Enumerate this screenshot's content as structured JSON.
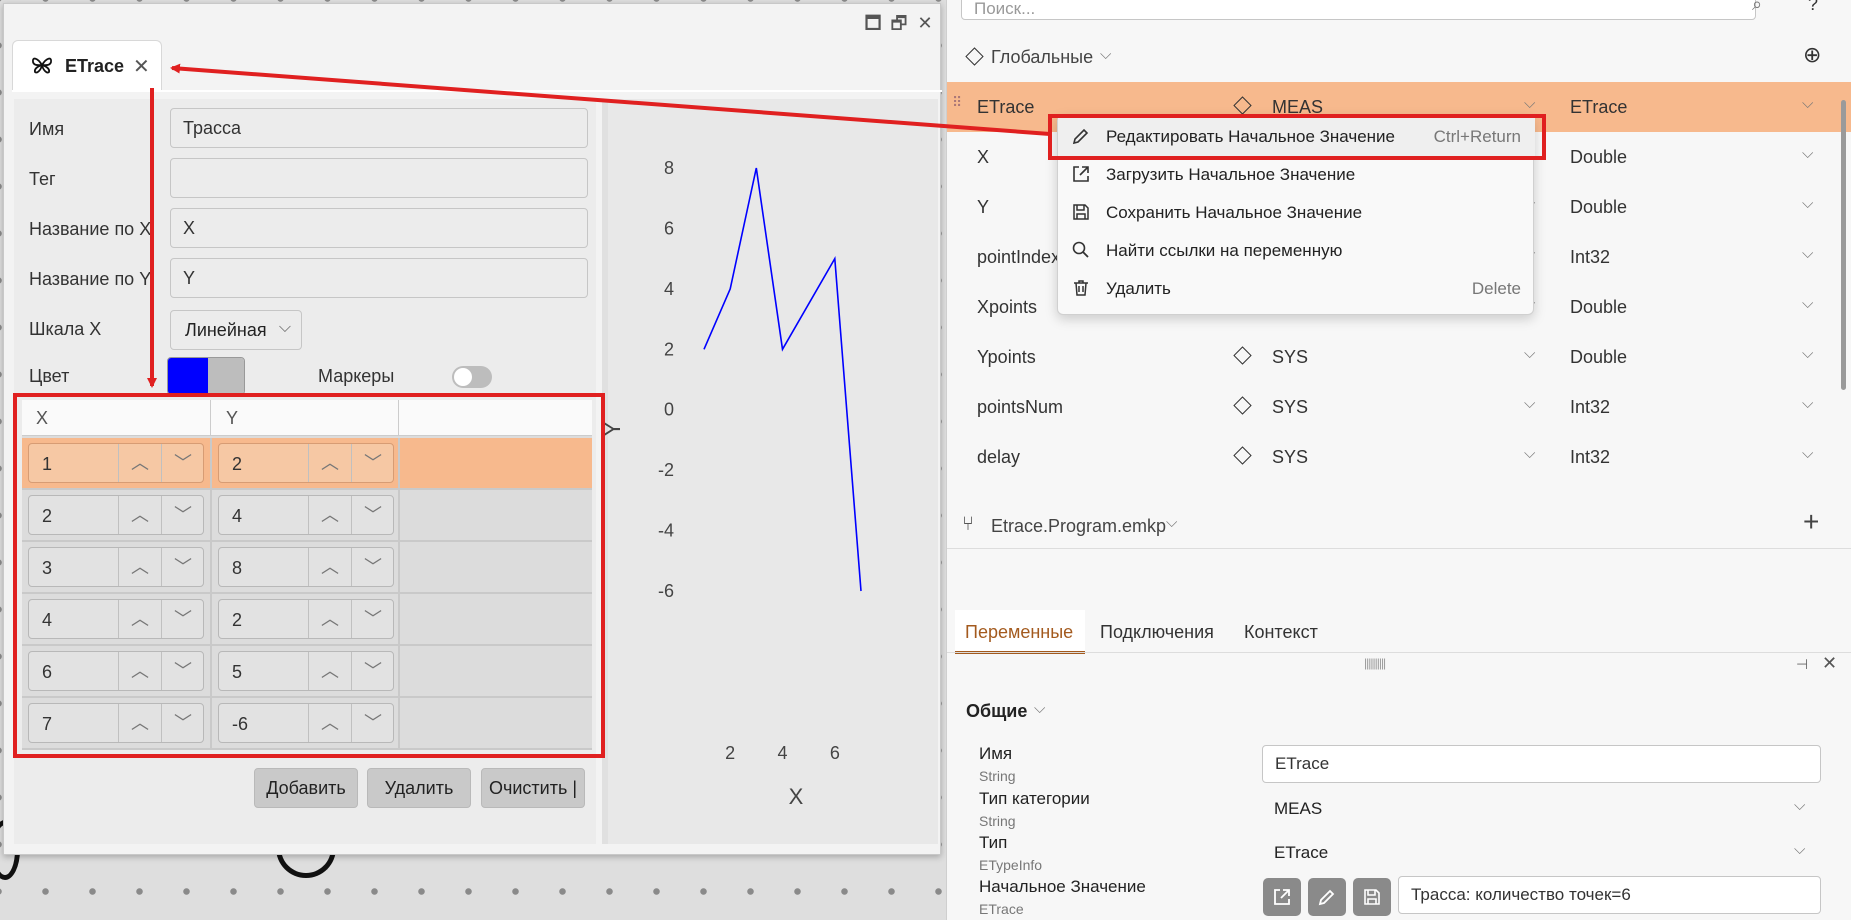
{
  "window": {
    "tab_title": "ETrace",
    "tab_close": "✕",
    "controls": {
      "minimize": "🗖",
      "restore": "🗗",
      "close": "✕"
    }
  },
  "form": {
    "name_label": "Имя",
    "name_value": "Трасса",
    "tag_label": "Тег",
    "tag_value": "",
    "xname_label": "Название по X",
    "xname_value": "X",
    "yname_label": "Название по Y",
    "yname_value": "Y",
    "scale_label": "Шкала X",
    "scale_value": "Линейная",
    "color_label": "Цвет",
    "color_value": "#0000ff",
    "markers_label": "Маркеры",
    "markers_on": false
  },
  "table": {
    "columns": [
      "X",
      "Y"
    ],
    "rows": [
      {
        "x": "1",
        "y": "2",
        "selected": true
      },
      {
        "x": "2",
        "y": "4",
        "selected": false
      },
      {
        "x": "3",
        "y": "8",
        "selected": false
      },
      {
        "x": "4",
        "y": "2",
        "selected": false
      },
      {
        "x": "6",
        "y": "5",
        "selected": false
      },
      {
        "x": "7",
        "y": "-6",
        "selected": false
      }
    ]
  },
  "buttons": {
    "add": "Добавить",
    "delete": "Удалить",
    "clear": "Очистить |"
  },
  "chart_data": {
    "type": "line",
    "x": [
      1,
      2,
      3,
      4,
      6,
      7
    ],
    "series": [
      {
        "values": [
          2,
          4,
          8,
          2,
          5,
          -6
        ],
        "color": "#0000ff"
      }
    ],
    "xlabel": "X",
    "ylabel": "Y",
    "xticks": [
      2,
      4,
      6
    ],
    "yticks": [
      8,
      6,
      4,
      2,
      0,
      -2,
      -4,
      -6
    ]
  },
  "right": {
    "search_placeholder": "Поиск...",
    "globals_label": "Глобальные",
    "variables": [
      {
        "name": "ETrace",
        "category": "MEAS",
        "type": "ETrace",
        "selected": true
      },
      {
        "name": "X",
        "category": "",
        "type": "Double"
      },
      {
        "name": "Y",
        "category": "",
        "type": "Double"
      },
      {
        "name": "pointIndex",
        "category": "",
        "type": "Int32"
      },
      {
        "name": "Xpoints",
        "category": "",
        "type": "Double"
      },
      {
        "name": "Ypoints",
        "category": "SYS",
        "type": "Double"
      },
      {
        "name": "pointsNum",
        "category": "SYS",
        "type": "Int32"
      },
      {
        "name": "delay",
        "category": "SYS",
        "type": "Int32"
      }
    ],
    "program_label": "Etrace.Program.emkp",
    "context_menu": [
      {
        "label": "Редактировать Начальное Значение",
        "shortcut": "Ctrl+Return",
        "icon": "pencil-icon"
      },
      {
        "label": "Загрузить Начальное Значение",
        "shortcut": "",
        "icon": "external-link-icon"
      },
      {
        "label": "Сохранить Начальное Значение",
        "shortcut": "",
        "icon": "save-icon"
      },
      {
        "label": "Найти ссылки на переменную",
        "shortcut": "",
        "icon": "search-icon"
      },
      {
        "label": "Удалить",
        "shortcut": "Delete",
        "icon": "trash-icon"
      }
    ],
    "tabs": [
      "Переменные",
      "Подключения",
      "Контекст"
    ],
    "section_label": "Общие",
    "props": {
      "name_label": "Имя",
      "name_type": "String",
      "name_value": "ETrace",
      "cat_label": "Тип категории",
      "cat_type": "String",
      "cat_value": "MEAS",
      "type_label": "Тип",
      "type_type": "ETypeInfo",
      "type_value": "ETrace",
      "init_label": "Начальное Значение",
      "init_type": "ETrace",
      "init_value": "Трасса: количество точек=6"
    }
  },
  "colors": {
    "accent": "#a35a1e",
    "selection": "#f7b98d",
    "annotation": "#e02020",
    "trace": "#0000ff"
  }
}
